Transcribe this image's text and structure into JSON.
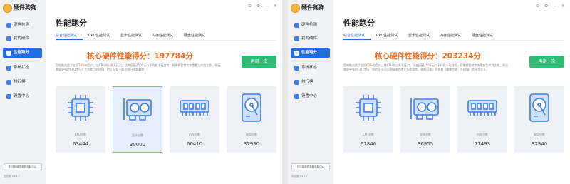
{
  "app": {
    "title": "硬件狗狗",
    "version": "测试版 V4.1.7",
    "promo": "已连接硬件狗狗电脑中心"
  },
  "sidebar": {
    "items": [
      {
        "label": "硬件检测",
        "icon": "hardware-detect-icon"
      },
      {
        "label": "我的硬件",
        "icon": "my-hardware-icon"
      },
      {
        "label": "性能跑分",
        "icon": "benchmark-icon",
        "active": true
      },
      {
        "label": "系统状态",
        "icon": "system-status-icon"
      },
      {
        "label": "排行榜",
        "icon": "ranking-icon"
      },
      {
        "label": "设置中心",
        "icon": "settings-icon"
      }
    ]
  },
  "page": {
    "title": "性能跑分",
    "tabs": [
      "综合性能测试",
      "CPU性能测试",
      "显卡性能测试",
      "内存性能测试",
      "硬盘性能测试"
    ],
    "retest_label": "再测一次"
  },
  "windows": [
    {
      "score_text": "核心硬件性能得分：197784分",
      "desc_pre": "您电脑击败了全国",
      "desc_pct": "58%",
      "desc_post": "的用户。该CPU的公乘无压力。适合搭配2500元以下的软卡玩游戏，如果想要做实体零售生产力工作，你还需要更强的CPU才行！工作累了的时候，约上好友一起去排行榜聊聊吧！",
      "cards": [
        {
          "label": "CPU分数",
          "value": "63444",
          "icon": "cpu-icon"
        },
        {
          "label": "显卡分数",
          "value": "30000",
          "icon": "gpu-icon"
        },
        {
          "label": "内存分数",
          "value": "66410",
          "icon": "memory-icon"
        },
        {
          "label": "磁盘分数",
          "value": "37930",
          "icon": "disk-icon"
        }
      ]
    },
    {
      "score_text": "核心硬件性能得分：203234分",
      "desc_pre": "您电脑击败了全国",
      "desc_pct": "62%",
      "desc_post": "的用户。该CPU的公乘无压力。适合搭配2500元以下的软卡玩游戏，如果想要做实体零售生产力工作，你还需要更强的CPU才行！你的显卡可以流畅体验绝大多数游戏，帧数可观，你将其《魔兽世界：怀旧服》也不在话下。",
      "cards": [
        {
          "label": "CPU分数",
          "value": "61846",
          "icon": "cpu-icon"
        },
        {
          "label": "显卡分数",
          "value": "36955",
          "icon": "gpu-icon"
        },
        {
          "label": "内存分数",
          "value": "71493",
          "icon": "memory-icon"
        },
        {
          "label": "磁盘分数",
          "value": "32940",
          "icon": "disk-icon"
        }
      ]
    }
  ],
  "colors": {
    "accent": "#1f6fe0",
    "score": "#f26b1d",
    "button": "#2ebb72",
    "icon": "#3f7ee8"
  }
}
